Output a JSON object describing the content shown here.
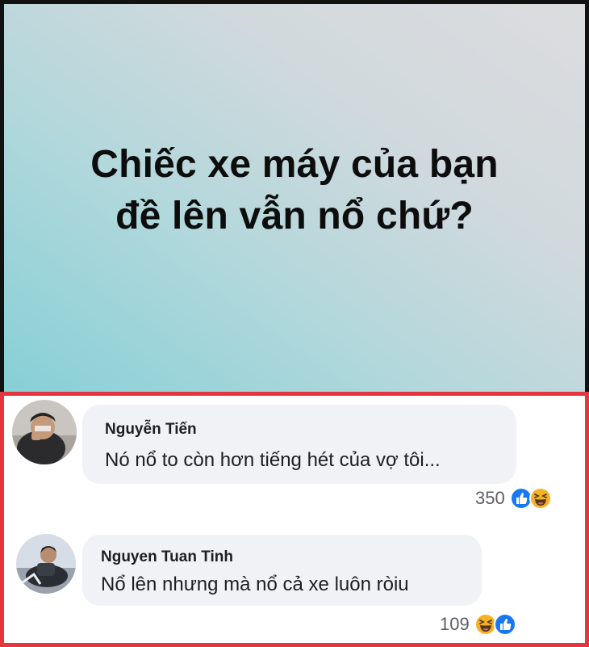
{
  "post": {
    "line1": "Chiếc xe máy của bạn",
    "line2": "đề lên vẫn nổ chứ?",
    "background_colors": [
      "#86d0d6",
      "#dcdcde"
    ]
  },
  "comments": [
    {
      "author": "Nguyễn Tiến",
      "text": "Nó nổ to còn hơn tiếng hét của vợ tôi...",
      "reaction_count": "350",
      "reactions": [
        "like-icon",
        "haha-icon"
      ]
    },
    {
      "author": "Nguyen Tuan Tinh",
      "text": "Nổ lên nhưng mà nổ cả xe luôn ròiu",
      "reaction_count": "109",
      "reactions": [
        "haha-icon",
        "like-icon"
      ]
    }
  ],
  "colors": {
    "highlight_border": "#e5363f",
    "bubble": "#f0f2f5",
    "like": "#1877f2",
    "haha": "#f7b125"
  }
}
